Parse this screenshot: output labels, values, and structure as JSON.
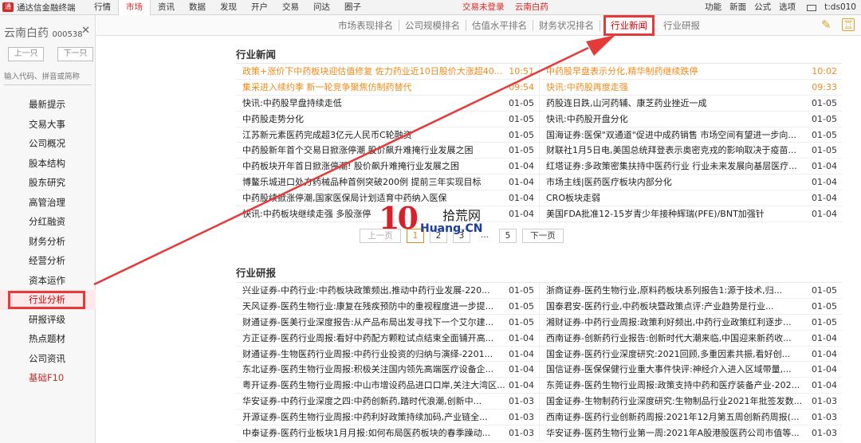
{
  "app": {
    "logo": "通",
    "title": "通达信金融终端"
  },
  "menu": [
    "行情",
    "市场",
    "资讯",
    "数据",
    "发现",
    "开户",
    "交易",
    "问达",
    "圈子"
  ],
  "menu_active": 1,
  "notice": {
    "trade_status": "交易未登录",
    "stock_name": "云南白药"
  },
  "topright": [
    "功能",
    "新面",
    "公式",
    "选项",
    "t:ds010"
  ],
  "stock": {
    "name": "云南白药",
    "code": "000538",
    "close": "✕"
  },
  "nav": {
    "prev": "上一只",
    "next": "下一只"
  },
  "search": {
    "placeholder": "输入代码、拼音或简称"
  },
  "side_items": [
    "最新提示",
    "交易大事",
    "公司概况",
    "股本结构",
    "股东研究",
    "高管治理",
    "分红融资",
    "财务分析",
    "经营分析",
    "资本运作",
    "行业分析",
    "研报评级",
    "热点题材",
    "公司资讯",
    "基础F10"
  ],
  "tabs": [
    "市场表现排名",
    "公司规模排名",
    "估值水平排名",
    "财务状况排名",
    "行业新闻",
    "行业研报"
  ],
  "news": {
    "title": "行业新闻",
    "rows": [
      [
        {
          "t": "政策+涨价下中药板块迎估值修复 佐力药业近10日股价大涨超40...",
          "d": "10:51",
          "hot": true
        },
        {
          "t": "中药股早盘表示分化,精华制药继续跌停",
          "d": "10:02",
          "hot": true
        }
      ],
      [
        {
          "t": "集采进入续约季 新一轮竞争聚焦仿制药替代",
          "d": "09:54",
          "hot": true
        },
        {
          "t": "快讯:中药股再度走强",
          "d": "09:33",
          "hot": true
        }
      ],
      [
        {
          "t": "快讯:中药股早盘持续走低",
          "d": "01-05"
        },
        {
          "t": "药股连日跌,山河药辅、康芝药业挫近一成",
          "d": "01-05"
        }
      ],
      [
        {
          "t": "中药股走势分化",
          "d": "01-05"
        },
        {
          "t": "快讯:中药股开盘分化",
          "d": "01-05"
        }
      ],
      [
        {
          "t": "江苏新元素医药完成超3亿元人民币C轮融资",
          "d": "01-05"
        },
        {
          "t": "国海证券:医保\"双通道\"促进中成药销售 市场空间有望进一步向...",
          "d": "01-05"
        }
      ],
      [
        {
          "t": "中药股新年首个交易日掀涨停潮 股价飙升难掩行业发展之困",
          "d": "01-05"
        },
        {
          "t": "财联社1月5日电,美国总统拜登表示奥密克戎的影响取决于疫苗...",
          "d": "01-05"
        }
      ],
      [
        {
          "t": "中药板块开年首日掀涨停潮! 股价飙升难掩行业发展之困",
          "d": "01-04"
        },
        {
          "t": "红塔证券:多政策密集扶持中医药行业 行业未来发展向基层医疗...",
          "d": "01-04"
        }
      ],
      [
        {
          "t": "博鳌乐城进口处方药械品种首例突破200例 提前三年实现目标",
          "d": "01-04"
        },
        {
          "t": "市场主线|医药医疗板块内部分化",
          "d": "01-04"
        }
      ],
      [
        {
          "t": "中药股续掀涨停潮,国家医保局计划适育中药纳入医保",
          "d": "01-04"
        },
        {
          "t": "CRO板块走弱",
          "d": "01-04"
        }
      ],
      [
        {
          "t": "快讯:中药板块继续走强 多股涨停",
          "d": "01-04"
        },
        {
          "t": "美国FDA批准12-15岁青少年接种辉瑞(PFE)/BNT加强针",
          "d": "01-04"
        }
      ]
    ]
  },
  "pager": {
    "prev": "上一页",
    "pages": [
      "1",
      "2",
      "3",
      "...",
      "5"
    ],
    "current": "1",
    "next": "下一页"
  },
  "reports": {
    "title": "行业研报",
    "rows": [
      [
        {
          "t": "兴业证券-中药行业:中药板块政策频出,推动中药行业发展-220...",
          "d": "01-05"
        },
        {
          "t": "浙商证券-医药生物行业,原料药板块系列报告1:源于技术,归...",
          "d": "01-05"
        }
      ],
      [
        {
          "t": "天风证券-医药生物行业:康复在残疾预防中的重视程度进一步提...",
          "d": "01-05"
        },
        {
          "t": "国泰君安-医药行业,中药板块暨政策点评:产业趋势是行业...",
          "d": "01-05"
        }
      ],
      [
        {
          "t": "财通证券-医美行业深度报告:从产品布局出发寻找下一个艾尔建...",
          "d": "01-05"
        },
        {
          "t": "湘财证券-中药行业周报:政策利好频出,中药行业政策红利逐步...",
          "d": "01-05"
        }
      ],
      [
        {
          "t": "方正证券-医药行业周报:看好中药配方颗粒试点结束全面铺开高...",
          "d": "01-04"
        },
        {
          "t": "西南证券-创新药行业报告:创新时代大潮来临,中国迎来新药收...",
          "d": "01-04"
        }
      ],
      [
        {
          "t": "财通证券-生物医药行业周报:中药行业投资的归纳与演绎-2201...",
          "d": "01-04"
        },
        {
          "t": "国金证券-医药行业深度研究:2021回顾,多重因素共振,看好创...",
          "d": "01-04"
        }
      ],
      [
        {
          "t": "东北证券-医药生物行业周报:积极关注国内领先高端医疗设备企...",
          "d": "01-04"
        },
        {
          "t": "国信证券-医保保健行业重大事件快评:神经介入进入区域带量,...",
          "d": "01-04"
        }
      ],
      [
        {
          "t": "粤开证券-医药生物行业周报:中山市增设药品进口口岸,关注大湾区...",
          "d": "01-04"
        },
        {
          "t": "东莞证券-医药生物行业周报:政策支持中药和医疗装备产业-202...",
          "d": "01-04"
        }
      ],
      [
        {
          "t": "华安证券-中药行业深度之四:中药创新药,踏时代浪潮,创新中...",
          "d": "01-03"
        },
        {
          "t": "国金证券-生物制药行业深度研究:生物制品行业2021年批签发数...",
          "d": "01-03"
        }
      ],
      [
        {
          "t": "开源证券-医药生物行业周报:中药利好政策持续加码,产业链全...",
          "d": "01-03"
        },
        {
          "t": "西南证券-医药行业创新药周报:2021年12月第五周创新药周报(...",
          "d": "01-03"
        }
      ],
      [
        {
          "t": "中泰证券-医药行业板块1月月报:如何布局医药板块的春季躁动...",
          "d": "01-03"
        },
        {
          "t": "华安证券-医药生物行业第一周:2021年A股港股医药公司市值等...",
          "d": "01-03"
        }
      ]
    ]
  },
  "watermark": {
    "big": "10",
    "cn": "拾荒网",
    "en": "Huang.CN"
  },
  "colors": {
    "accent_red": "#e02020",
    "hot_orange": "#f08a1c",
    "arrow_red": "#e43a3a"
  }
}
